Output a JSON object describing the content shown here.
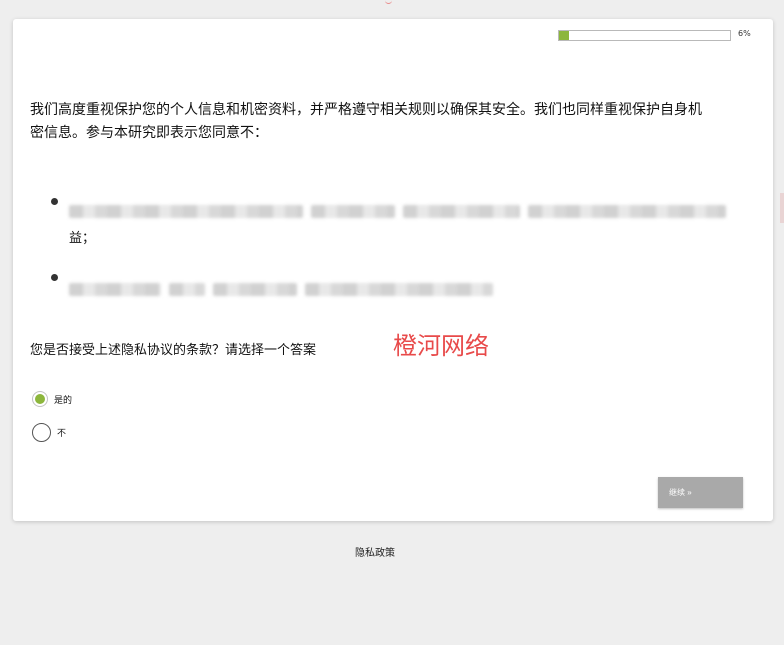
{
  "progress": {
    "fraction": 0.06,
    "label": "6%"
  },
  "intro_text": "我们高度重视保护您的个人信息和机密资料，并严格遵守相关规则以确保其安全。我们也同样重视保护自身机密信息。参与本研究即表示您同意不：",
  "bullets": [
    {
      "trailing_text": "益；"
    }
  ],
  "question": "您是否接受上述隐私协议的条款？请选择一个答案",
  "watermark": "橙河网络",
  "options": [
    {
      "label": "是的",
      "selected": true
    },
    {
      "label": "不",
      "selected": false
    }
  ],
  "continue_label": "继续 »",
  "footer": {
    "privacy_link": "隐私政策"
  },
  "colors": {
    "accent": "#8cb63c",
    "button": "#a9a9a9",
    "watermark": "#e84a4a",
    "background": "#eeeeee"
  }
}
